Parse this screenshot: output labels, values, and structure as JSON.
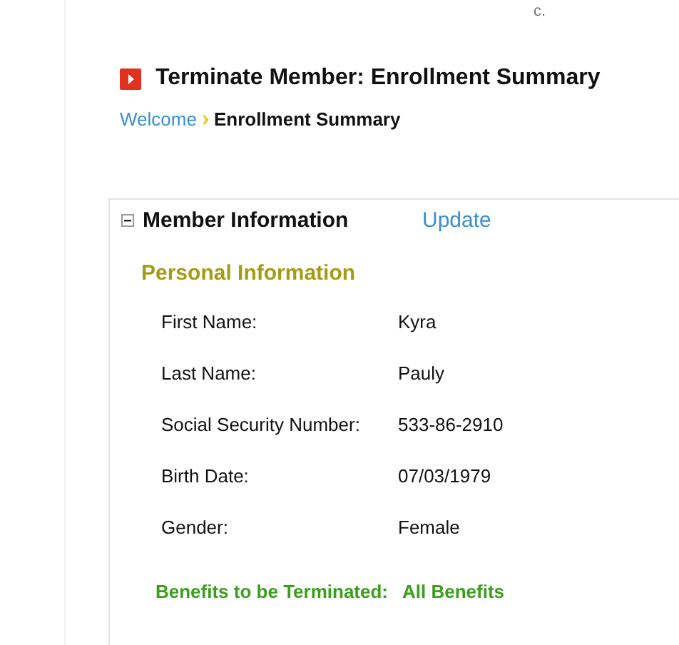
{
  "corner_text": "c.",
  "page_title": "Terminate Member: Enrollment Summary",
  "breadcrumb": [
    {
      "label": "Welcome",
      "kind": "link"
    },
    {
      "label": "Enrollment Summary",
      "kind": "current"
    }
  ],
  "section": {
    "title": "Member Information",
    "expanded": true,
    "action": "Update",
    "subsection": "Personal Information",
    "fields": [
      {
        "label": "First Name:",
        "value": "Kyra"
      },
      {
        "label": "Last Name:",
        "value": "Pauly"
      },
      {
        "label": "Social Security Number:",
        "value": "533-86-2910"
      },
      {
        "label": "Birth Date:",
        "value": "07/03/1979"
      },
      {
        "label": "Gender:",
        "value": "Female"
      }
    ],
    "benefits": {
      "label": "Benefits to be Terminated:",
      "value": "All Benefits"
    }
  }
}
